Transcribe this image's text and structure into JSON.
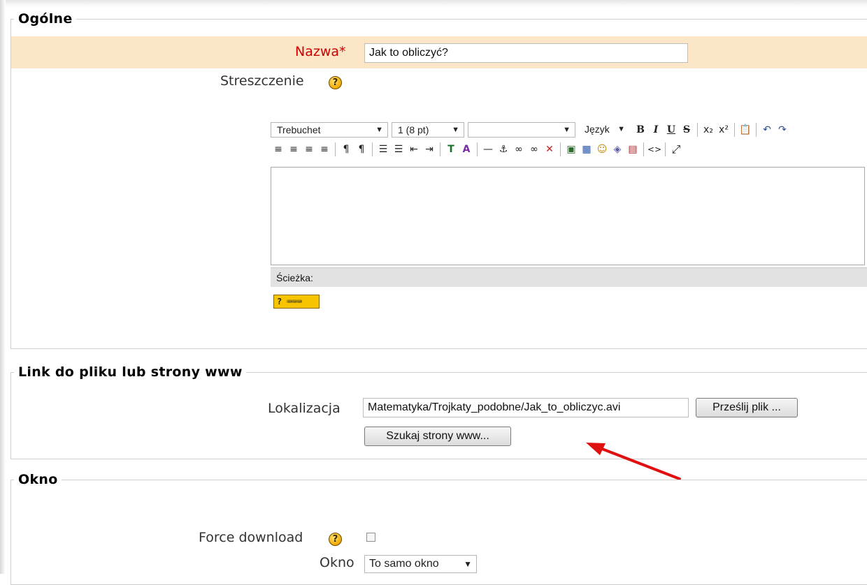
{
  "sections": {
    "general": {
      "title": "Ogólne"
    },
    "link": {
      "title": "Link do pliku lub strony www"
    },
    "window": {
      "title": "Okno"
    }
  },
  "form": {
    "name": {
      "label": "Nazwa",
      "required_mark": "*",
      "value": "Jak to obliczyć?"
    },
    "summary": {
      "label": "Streszczenie",
      "help_icon": "help-icon"
    },
    "location": {
      "label": "Lokalizacja",
      "value": "Matematyka/Trojkaty_podobne/Jak_to_obliczyc.avi",
      "upload_button": "Prześlij plik ...",
      "search_button": "Szukaj strony www..."
    },
    "force_download": {
      "label": "Force download",
      "checked": false
    },
    "window": {
      "label": "Okno",
      "selected": "To samo okno"
    }
  },
  "editor": {
    "font": "Trebuchet",
    "size": "1 (8 pt)",
    "format": "",
    "language": "Język",
    "path_label": "Ścieżka:",
    "toolbar_row1": [
      "B",
      "I",
      "U",
      "S",
      "x₂",
      "x²",
      "📋",
      "↶",
      "↷"
    ],
    "toolbar_row2": [
      "≡",
      "≡",
      "≡",
      "≡",
      "¶",
      "¶",
      "☰",
      "☰",
      "⇤",
      "⇥",
      "T",
      "A",
      "—",
      "⚓",
      "∞",
      "∞",
      "✕",
      "▣",
      "▦",
      "☺",
      "◈",
      "▤",
      "<>",
      "⤢"
    ]
  },
  "colors": {
    "highlight_row": "#fbe6c8",
    "required": "#cc0000",
    "arrow": "#e01010"
  }
}
